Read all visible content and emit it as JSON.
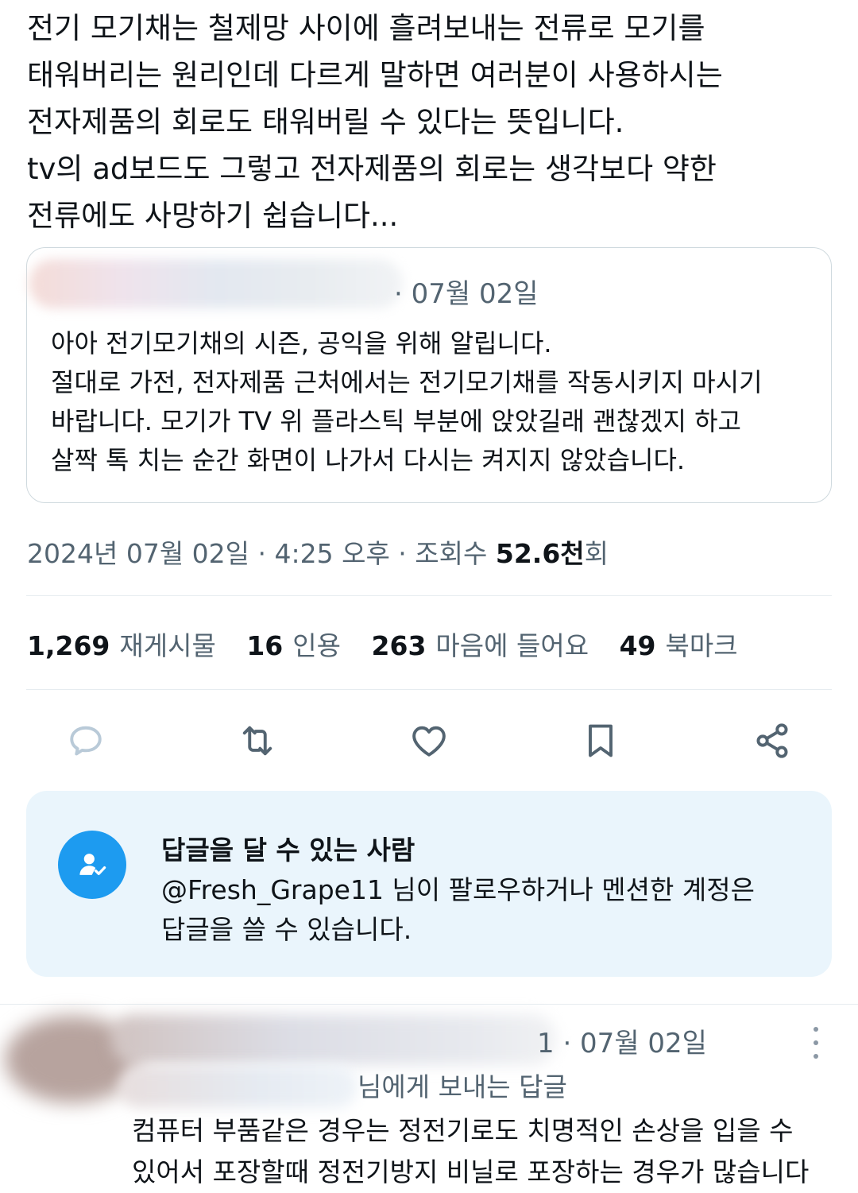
{
  "tweet": {
    "lines": [
      "전기 모기채는 철제망 사이에 흘려보내는 전류로 모기를",
      "태워버리는 원리인데 다르게 말하면 여러분이 사용하시는",
      "전자제품의 회로도 태워버릴 수 있다는 뜻입니다.",
      "tv의 ad보드도 그렇고 전자제품의 회로는 생각보다 약한",
      "전류에도 사망하기 쉽습니다..."
    ]
  },
  "quote": {
    "date": "· 07월 02일",
    "lines": [
      "아아 전기모기채의 시즌, 공익을 위해 알립니다.",
      "절대로 가전, 전자제품 근처에서는 전기모기채를 작동시키지 마시기",
      "바랍니다. 모기가 TV 위 플라스틱 부분에 앉았길래 괜찮겠지 하고",
      "살짝 톡 치는 순간 화면이 나가서 다시는 켜지지 않았습니다."
    ]
  },
  "meta": {
    "datetime": "2024년 07월 02일 · 4:25 오후 · 조회수 ",
    "views_count": "52.6천",
    "views_unit": "회"
  },
  "stats": {
    "reposts": {
      "num": "1,269",
      "label": "재게시물"
    },
    "quotes": {
      "num": "16",
      "label": "인용"
    },
    "likes": {
      "num": "263",
      "label": "마음에 들어요"
    },
    "bookmarks": {
      "num": "49",
      "label": "북마크"
    }
  },
  "actions": {
    "icons": [
      "reply-icon",
      "repost-icon",
      "like-icon",
      "bookmark-icon",
      "share-icon"
    ],
    "color": "#536471"
  },
  "reply_permissions": {
    "title": "답글을 달 수 있는 사람",
    "lines": [
      "@Fresh_Grape11 님이 팔로우하거나 멘션한 계정은",
      "답글을 쓸 수 있습니다."
    ],
    "accent": "#1d9bf0",
    "background": "#eaf5fc"
  },
  "reply": {
    "date": "1 · 07월 02일",
    "replying_to": "님에게 보내는 답글",
    "lines": [
      "컴퓨터 부품같은 경우는 정전기로도 치명적인 손상을 입을 수",
      "있어서 포장할때 정전기방지 비닐로 포장하는 경우가 많습니다"
    ]
  }
}
